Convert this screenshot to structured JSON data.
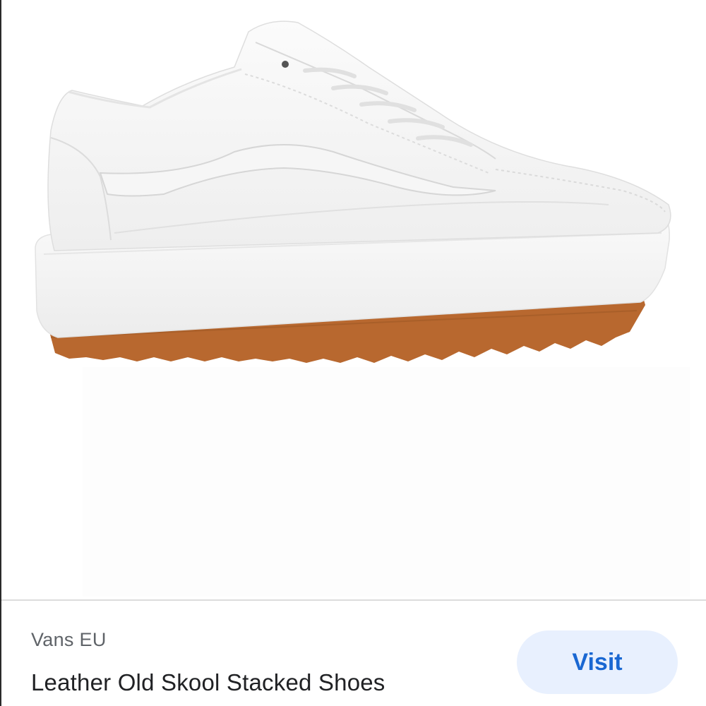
{
  "product": {
    "image_icon": "shoe-image",
    "source": "Vans EU",
    "title": "Leather Old Skool Stacked Shoes",
    "visit_label": "Visit"
  },
  "colors": {
    "accent_text": "#1967d2",
    "button_bg": "#e8f0fe",
    "sole_gum": "#b5652e"
  }
}
